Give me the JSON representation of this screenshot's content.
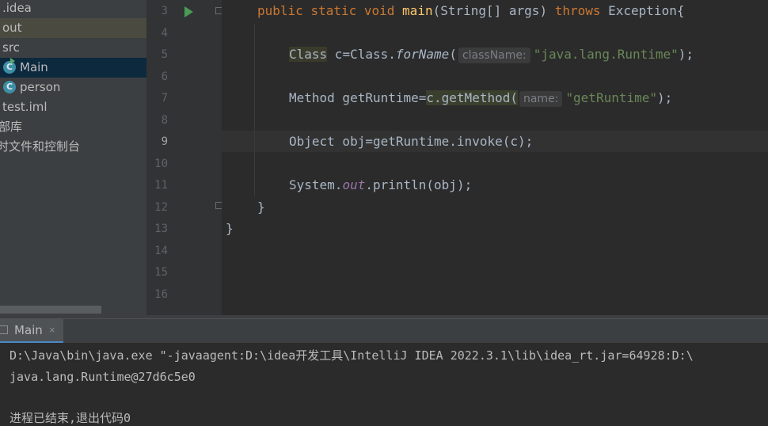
{
  "project_tree": {
    "items": [
      {
        "label": ".idea"
      },
      {
        "label": "out"
      },
      {
        "label": "src"
      },
      {
        "label": "Main",
        "icon": "class-icon"
      },
      {
        "label": "person",
        "icon": "class-icon"
      },
      {
        "label": "test.iml"
      },
      {
        "label": "部库"
      },
      {
        "label": "时文件和控制台"
      }
    ],
    "class_icon_letter": "C"
  },
  "editor": {
    "line_numbers": [
      "3",
      "4",
      "5",
      "6",
      "7",
      "8",
      "9",
      "10",
      "11",
      "12",
      "13",
      "14",
      "15",
      "16"
    ],
    "current_line": "9",
    "tokens": {
      "l3_public": "public",
      "l3_static": "static",
      "l3_void": "void",
      "l3_main": "main",
      "l3_params": "(String[] args) ",
      "l3_throws": "throws",
      "l3_exception": " Exception{",
      "l5_class": "Class",
      "l5_assign": " c=Class.",
      "l5_forname": "forName",
      "l5_paren": "(",
      "l5_hint": "className:",
      "l5_str": "\"java.lang.Runtime\"",
      "l5_end": ");",
      "l7_method": "Method getRuntime=",
      "l7_getmethod": "c.getMethod(",
      "l7_hint": "name:",
      "l7_str": "\"getRuntime\"",
      "l7_end": ");",
      "l9_code": "Object obj=getRuntime.invoke(c);",
      "l11_system": "System.",
      "l11_out": "out",
      "l11_println": ".println(obj);",
      "l12_brace": "}",
      "l13_brace": "}"
    }
  },
  "run_panel": {
    "tab_label": "Main",
    "close_glyph": "×",
    "console_lines": [
      "D:\\Java\\bin\\java.exe \"-javaagent:D:\\idea开发工具\\IntelliJ IDEA 2022.3.1\\lib\\idea_rt.jar=64928:D:\\",
      "java.lang.Runtime@27d6c5e0",
      "进程已结束,退出代码0"
    ]
  },
  "colors": {
    "keyword": "#cc7832",
    "method_decl": "#ffc66d",
    "string": "#6a8759",
    "static_field": "#9876aa",
    "text": "#a9b7c6"
  }
}
